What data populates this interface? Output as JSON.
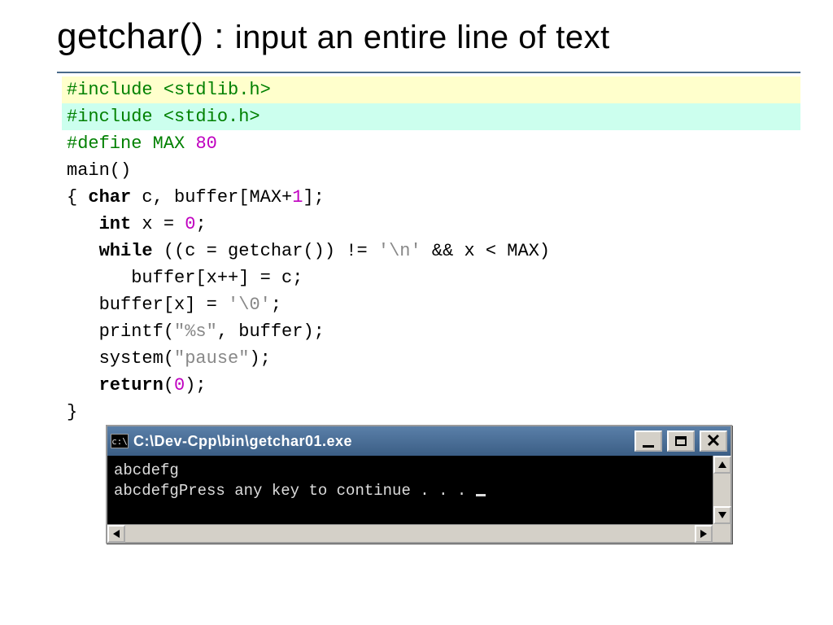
{
  "slide": {
    "title_main": "getchar() : ",
    "title_sub": "input an entire line of text"
  },
  "code": {
    "l1": "#include <stdlib.h>",
    "l2": "#include <stdio.h>",
    "l3_a": "#define MAX ",
    "l3_num": "80",
    "l4": "main()",
    "l5_a": "{ ",
    "l5_kw": "char",
    "l5_b": " c, buffer[MAX+",
    "l5_num": "1",
    "l5_c": "];",
    "l6_a": "   ",
    "l6_kw": "int",
    "l6_b": " x = ",
    "l6_num": "0",
    "l6_c": ";",
    "l7_a": "   ",
    "l7_kw": "while",
    "l7_b": " ((c = getchar()) != ",
    "l7_s1": "'\\n'",
    "l7_c": " && x < MAX)",
    "l8": "      buffer[x++] = c;",
    "l9_a": "   buffer[x] = ",
    "l9_s": "'\\0'",
    "l9_b": ";",
    "l10_a": "   printf(",
    "l10_s": "\"%s\"",
    "l10_b": ", buffer);",
    "l11_a": "   system(",
    "l11_s": "\"pause\"",
    "l11_b": ");",
    "l12_a": "   ",
    "l12_kw": "return",
    "l12_b": "(",
    "l12_num": "0",
    "l12_c": ");",
    "l13": "}"
  },
  "console": {
    "icon_label": "c:\\",
    "title": "C:\\Dev-Cpp\\bin\\getchar01.exe",
    "out1": "abcdefg",
    "out2": "abcdefgPress any key to continue . . . "
  }
}
